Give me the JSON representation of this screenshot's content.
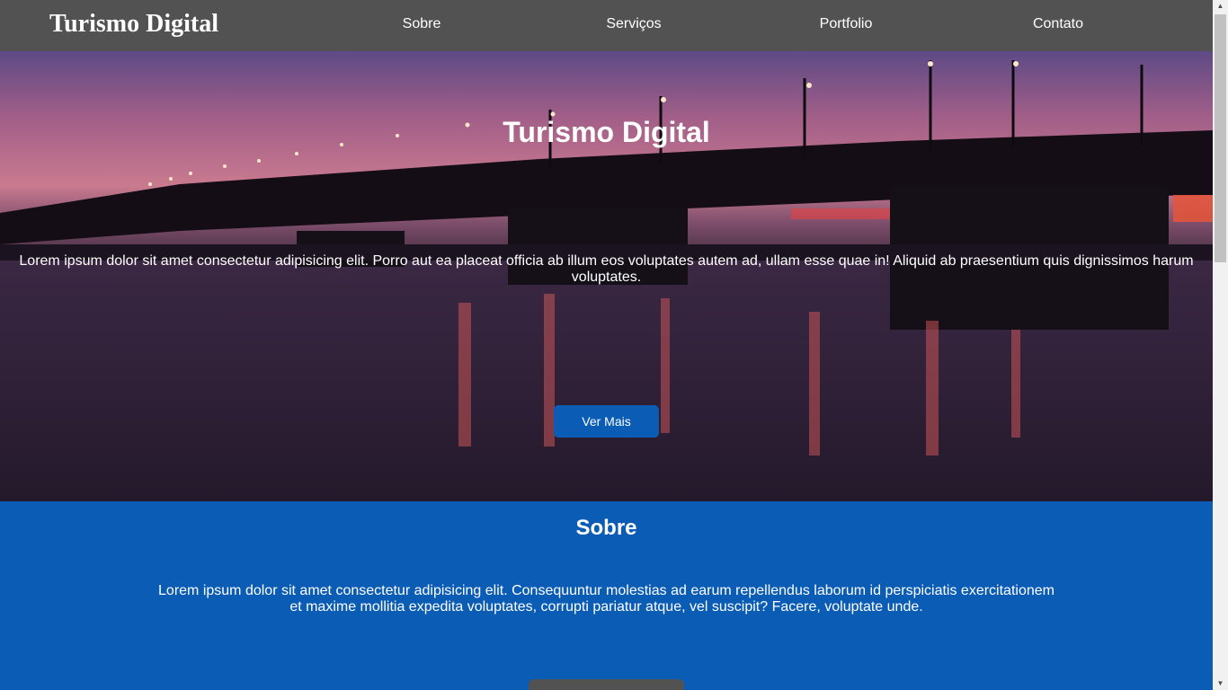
{
  "header": {
    "logo": "Turismo Digital",
    "nav": [
      "Sobre",
      "Serviços",
      "Portfolio",
      "Contato"
    ]
  },
  "hero": {
    "title": "Turismo Digital",
    "text": "Lorem ipsum dolor sit amet consectetur adipisicing elit. Porro aut ea placeat officia ab illum eos voluptates autem ad, ullam esse quae in! Aliquid ab praesentium quis dignissimos harum voluptates.",
    "button": "Ver Mais"
  },
  "about": {
    "title": "Sobre",
    "text": "Lorem ipsum dolor sit amet consectetur adipisicing elit. Consequuntur molestias ad earum repellendus laborum id perspiciatis exercitationem et maxime mollitia expedita voluptates, corrupti pariatur atque, vel suscipit? Facere, voluptate unde."
  },
  "colors": {
    "header_bg": "#525252",
    "accent_blue": "#0a5cb5",
    "text": "#ffffff"
  },
  "icons": {
    "scroll_up": "triangle-up-icon",
    "scroll_down": "triangle-down-icon"
  }
}
